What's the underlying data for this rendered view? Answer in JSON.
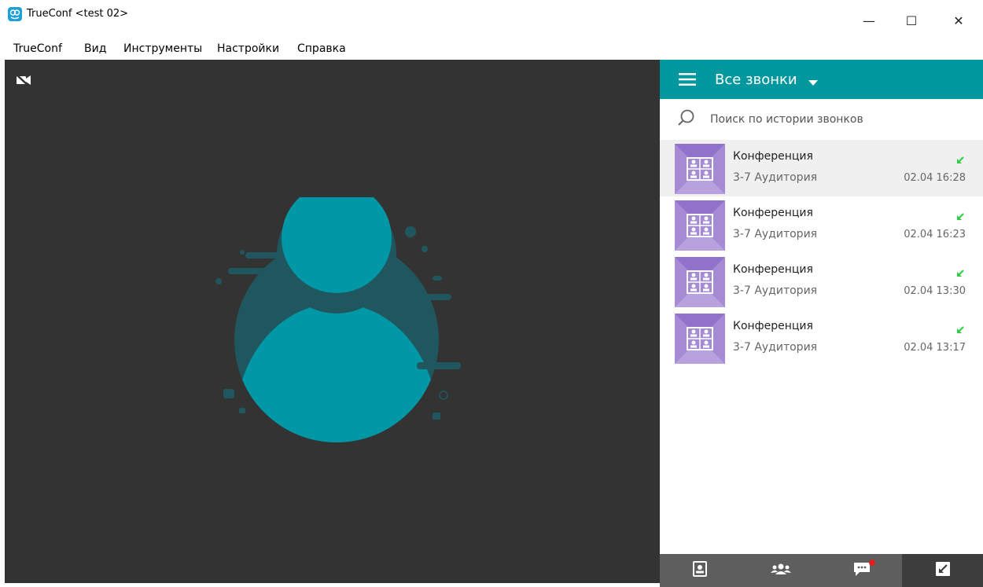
{
  "window": {
    "title": "TrueConf <test 02>",
    "minimize_symbol": "—",
    "maximize_symbol": "☐",
    "close_symbol": "✕"
  },
  "menu": {
    "items": [
      "TrueConf",
      "Вид",
      "Инструменты",
      "Настройки",
      "Справка"
    ]
  },
  "panel": {
    "filter_label": "Все звонки",
    "search_placeholder": "Поиск по истории звонков",
    "calls": [
      {
        "name": "Конференция",
        "room": "3-7 Аудитория",
        "time": "02.04 16:28",
        "direction": "incoming",
        "selected": true
      },
      {
        "name": "Конференция",
        "room": "3-7 Аудитория",
        "time": "02.04 16:23",
        "direction": "incoming",
        "selected": false
      },
      {
        "name": "Конференция",
        "room": "3-7 Аудитория",
        "time": "02.04 13:30",
        "direction": "incoming",
        "selected": false
      },
      {
        "name": "Конференция",
        "room": "3-7 Аудитория",
        "time": "02.04 13:17",
        "direction": "incoming",
        "selected": false
      }
    ]
  },
  "bottom_nav": {
    "items": [
      "contacts-icon",
      "conferences-icon",
      "chat-icon",
      "call-history-icon"
    ],
    "active": "call-history-icon"
  },
  "colors": {
    "accent": "#00979e",
    "video_bg": "#333333",
    "nav_bg": "#5e5e5e",
    "incoming_arrow": "#2ecc40",
    "conference_thumb": "#a58bd4"
  }
}
